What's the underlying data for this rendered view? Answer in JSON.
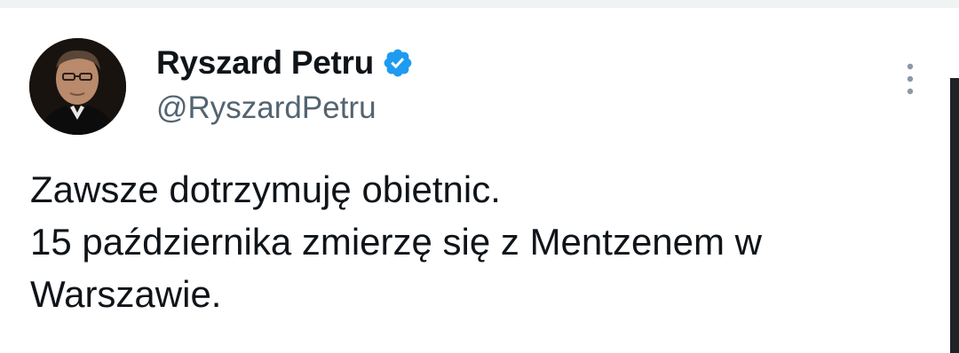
{
  "tweet": {
    "author": {
      "display_name": "Ryszard Petru",
      "handle": "@RyszardPetru",
      "verified": true,
      "avatar_icon": "profile-photo"
    },
    "more_icon": "more-vertical-icon",
    "text": "Zawsze dotrzymuję obietnic.\n15 października zmierzę się z Mentzenem w Warszawie."
  },
  "colors": {
    "text_primary": "#0f1419",
    "text_secondary": "#536471",
    "verified_blue": "#1d9bf0",
    "background": "#ffffff"
  }
}
